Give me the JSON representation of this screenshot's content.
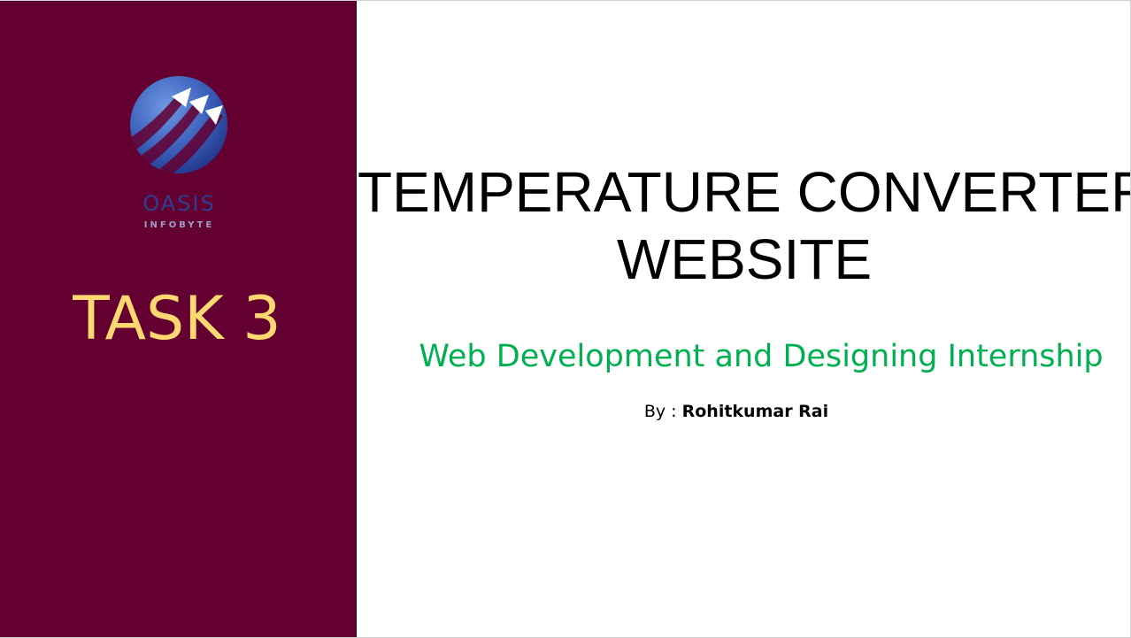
{
  "left_panel": {
    "background_color": "#630031",
    "logo": {
      "wordmark": "OASIS",
      "tagline": "INFOBYTE",
      "icon": "globe-arrows-logo-icon",
      "colors": {
        "globe_light": "#5a86d6",
        "globe_dark": "#233b93",
        "wordmark": "#2f3f8f",
        "tagline": "#9aa0c8"
      }
    },
    "task_label": "TASK 3",
    "task_color": "#ffd872"
  },
  "main": {
    "title_line_1": "TEMPERATURE CONVERTER",
    "title_line_2": "WEBSITE",
    "subtitle": "Web Development and Designing Internship",
    "subtitle_color": "#00b050",
    "byline_prefix": "By : ",
    "author": "Rohitkumar Rai"
  }
}
